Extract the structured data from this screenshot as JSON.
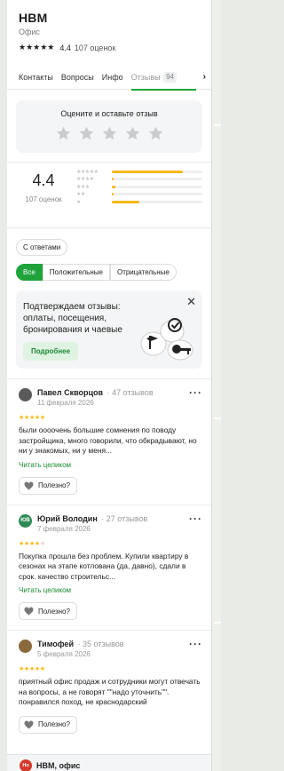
{
  "org": {
    "title": "НВМ",
    "category": "Офис",
    "rating": "4.4",
    "reviews_count": "107 оценок"
  },
  "tabs": [
    {
      "label": "Контакты"
    },
    {
      "label": "Вопросы"
    },
    {
      "label": "Инфо"
    },
    {
      "label": "Отзывы",
      "badge": "94"
    }
  ],
  "rate_prompt": "Оцените и оставьте отзыв",
  "summary": {
    "rating": "4.4",
    "count": "107 оценок",
    "distribution_fraction": [
      0.78,
      0.02,
      0.04,
      0.02,
      0.3
    ]
  },
  "chip_answers": "С ответами",
  "filters": [
    {
      "label": "Все",
      "active": true
    },
    {
      "label": "Положительные",
      "active": false
    },
    {
      "label": "Отрицательные",
      "active": false
    }
  ],
  "promo": {
    "text": "Подтверждаем отзывы: оплаты, посещения, бронирования и чаевые",
    "button": "Подробнее"
  },
  "reviews": [
    {
      "author": "Павел Скворцов",
      "count": "· 47 отзывов",
      "date": "11 февраля 2026",
      "stars": 5,
      "text": "были оооочень большие сомнения по поводу застройщика, много говорили, что обкрадывают, но ни у знакомых, ни у меня...",
      "read_more": "Читать целиком",
      "useful": "Полезно?",
      "avatar_color": "#555555"
    },
    {
      "author": "Юрий Володин",
      "count": "· 27 отзывов",
      "date": "7 февраля 2026",
      "stars": 4,
      "text": "Покупка прошла без проблем. Купили квартиру в сезонах на этапе котлована (да, давно), сдали в срок. качество строительс...",
      "read_more": "Читать целиком",
      "useful": "Полезно?",
      "avatar_text": "ЮВ",
      "avatar_color": "#2e8b57"
    },
    {
      "author": "Тимофей",
      "count": "· 35 отзывов",
      "date": "5 февраля 2026",
      "stars": 5,
      "text": "приятный офис продаж и сотрудники могут отвечать на вопросы, а не говорят \"\"надо уточнить\"\". понравился поход, не краснодарский",
      "useful": "Полезно?",
      "avatar_color": "#8a6a3a"
    }
  ],
  "bottom_card": {
    "logo_text": "Но",
    "title": "НВМ, офис"
  }
}
